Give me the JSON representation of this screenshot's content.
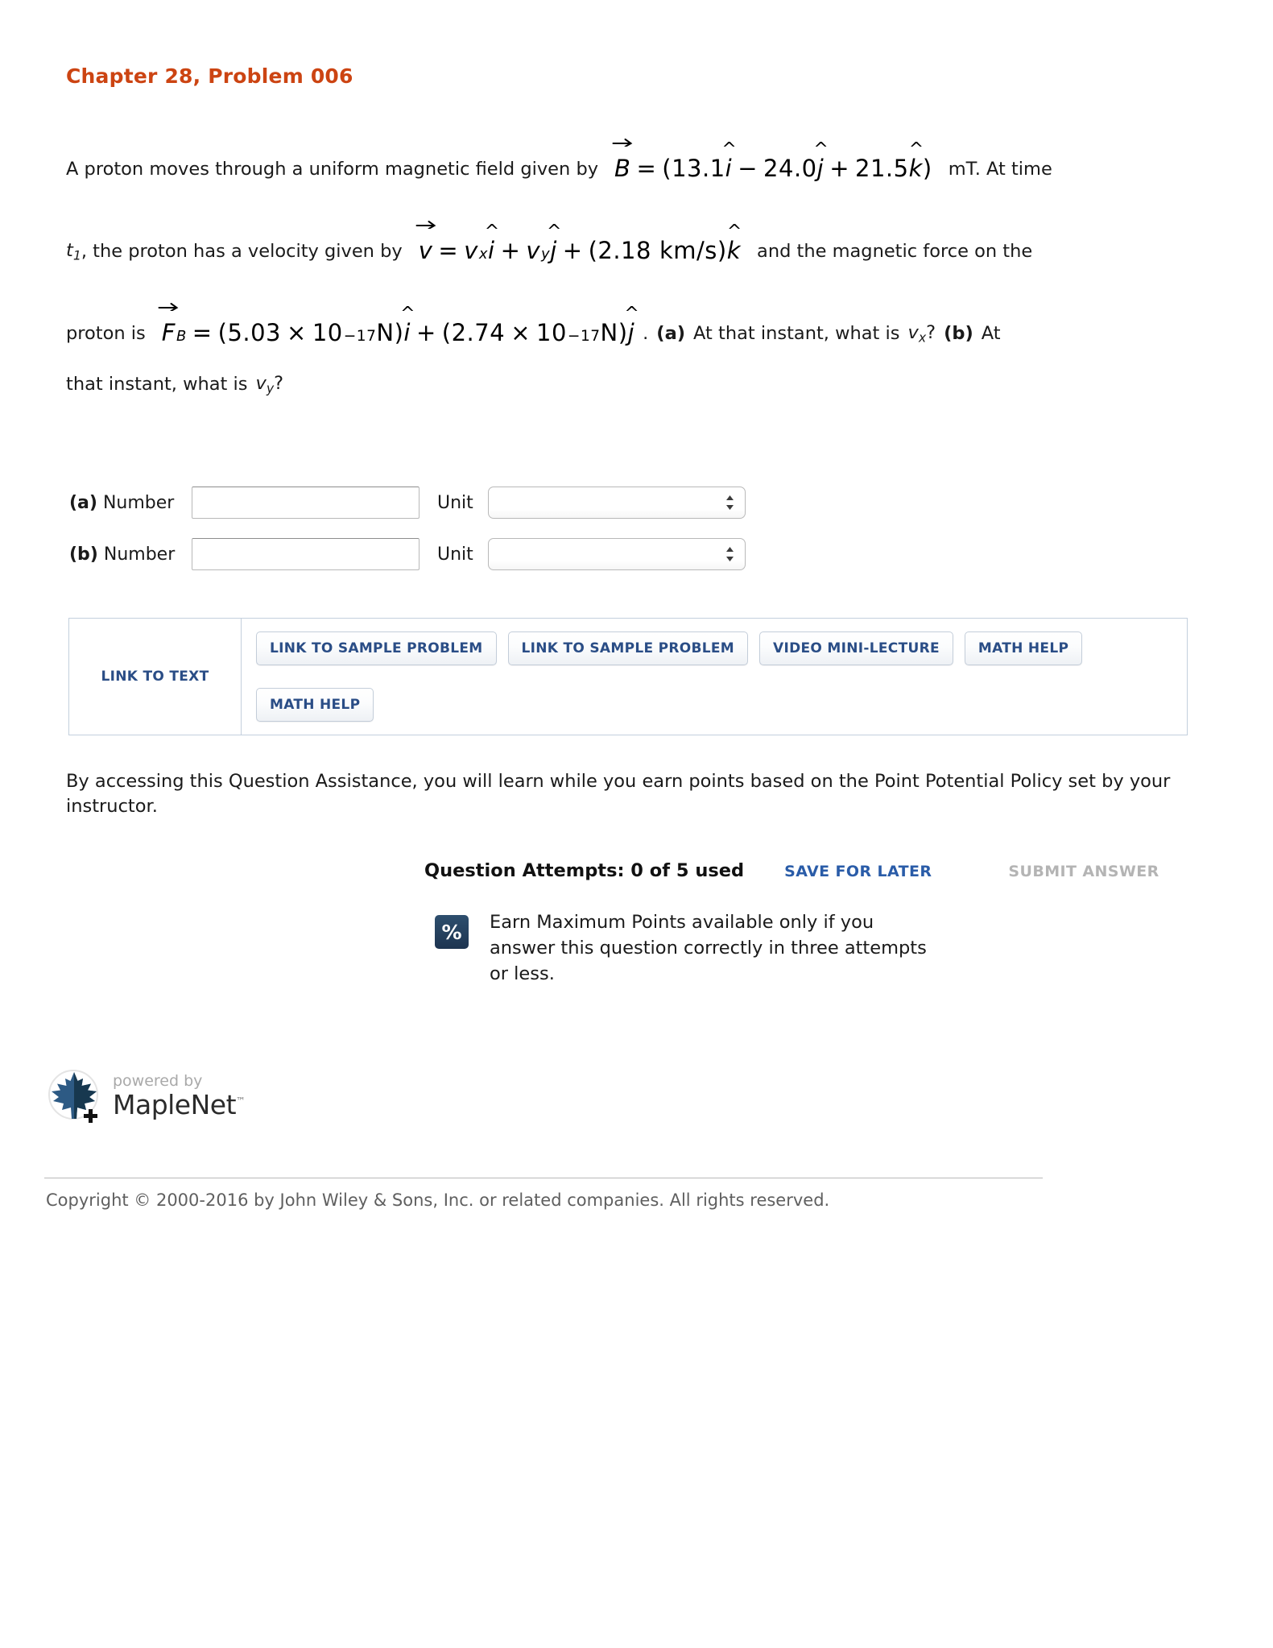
{
  "title": "Chapter 28, Problem 006",
  "statement": {
    "line1_before": "A proton moves through a uniform magnetic field given by",
    "eq_B": {
      "symbol": "B",
      "equals": "=",
      "open": "(",
      "term1_num": "13.1",
      "term1_unit": "i",
      "minus": "−",
      "term2_num": "24.0",
      "term2_unit": "j",
      "plus": "+",
      "term3_num": "21.5",
      "term3_unit": "k",
      "close": ")"
    },
    "line1_after": "mT. At time",
    "line2_before_t": "t",
    "line2_before_sub": "1",
    "line2_before_rest": ", the proton has a velocity given by",
    "eq_v": {
      "symbol": "v",
      "equals": "=",
      "vx_v": "v",
      "vx_sub": "x",
      "vx_unit": "i",
      "plus1": "+",
      "vy_v": "v",
      "vy_sub": "y",
      "vy_unit": "j",
      "plus2": "+",
      "open": "(",
      "value": "2.18",
      "units": "km/s",
      "close": ")",
      "khat": "k"
    },
    "line2_after": "and the magnetic force on the",
    "line3_before": "proton is",
    "eq_F": {
      "symbol": "F",
      "subscript": "B",
      "equals": "=",
      "open1": "(",
      "coef1": "5.03",
      "times": "×",
      "base": "10",
      "exp": "−17",
      "unitN": "N",
      "close1": ")",
      "ihat": "i",
      "plus": "+",
      "open2": "(",
      "coef2": "2.74",
      "close2": ")",
      "jhat": "j"
    },
    "line3_after_period": ".",
    "line3_qa_label": "(a)",
    "line3_qa_text": "At that instant, what is",
    "line3_qa_var_v": "v",
    "line3_qa_var_sub": "x",
    "line3_qa_q": "?",
    "line3_qb_label": "(b)",
    "line3_qb_text": "At",
    "line4_text": "that instant, what is",
    "line4_var_v": "v",
    "line4_var_sub": "y",
    "line4_q": "?"
  },
  "answers": {
    "rows": [
      {
        "prefix": "(a)",
        "label": "Number",
        "value": "",
        "placeholder": "",
        "unit_label": "Unit",
        "unit_value": ""
      },
      {
        "prefix": "(b)",
        "label": "Number",
        "value": "",
        "placeholder": "",
        "unit_label": "Unit",
        "unit_value": ""
      }
    ]
  },
  "links_box": {
    "link_to_text": "LINK TO TEXT",
    "buttons": [
      "LINK TO SAMPLE PROBLEM",
      "LINK TO SAMPLE PROBLEM",
      "VIDEO MINI-LECTURE",
      "MATH HELP",
      "MATH HELP"
    ]
  },
  "accessing_note": "By accessing this Question Assistance, you will learn while you earn points based on the Point Potential Policy set by your instructor.",
  "attempts": {
    "text": "Question Attempts: 0 of 5 used",
    "save_for_later": "SAVE FOR LATER",
    "submit_answer": "SUBMIT ANSWER"
  },
  "max_points": {
    "icon_glyph": "%",
    "text": "Earn Maximum Points available only if you answer this question correctly in three attempts or less."
  },
  "maplenet": {
    "powered_by": "powered by",
    "name": "MapleNet",
    "tm": "™"
  },
  "copyright": "Copyright © 2000-2016 by John Wiley & Sons, Inc. or related companies. All rights reserved.",
  "colors": {
    "title": "#cc4412",
    "link_blue": "#2a4d86",
    "save_blue": "#2a5ca8",
    "submit_gray": "#b4b4b4",
    "box_border": "#c3cfdd",
    "icon_navy": "#1d3450"
  }
}
